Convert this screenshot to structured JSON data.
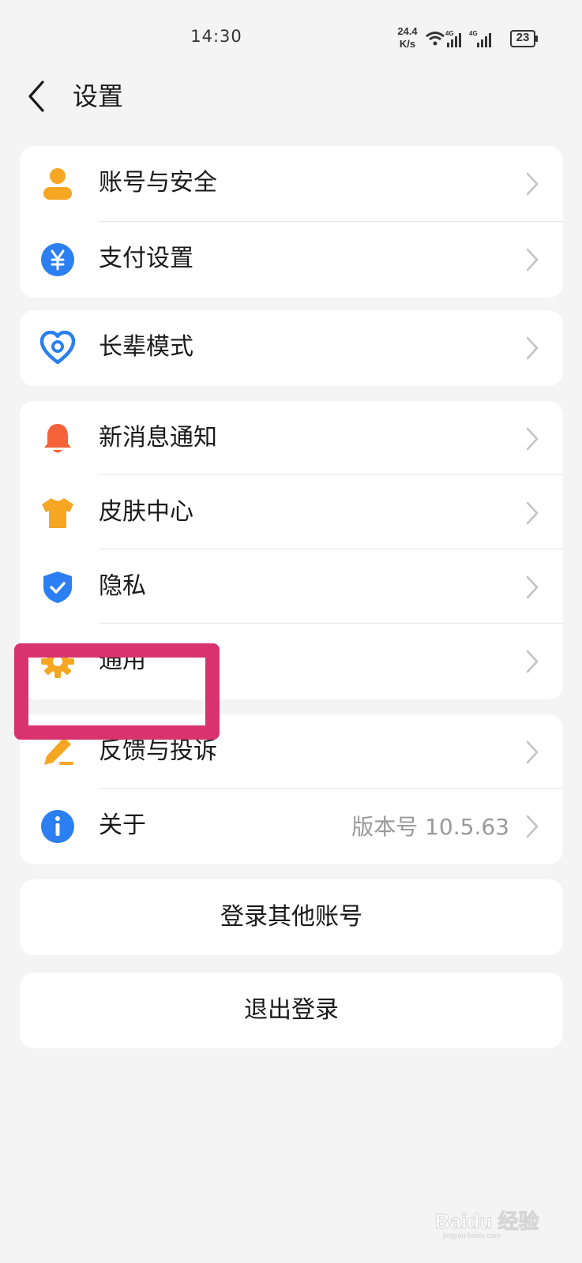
{
  "status_bar": {
    "time": "14:30",
    "net_speed_value": "24.4",
    "net_speed_unit": "K/s",
    "signal1_label": "4G",
    "signal2_label": "4G",
    "battery": "23"
  },
  "header": {
    "title": "设置"
  },
  "groups": [
    {
      "items": [
        {
          "label": "账号与安全",
          "icon": "user-icon"
        },
        {
          "label": "支付设置",
          "icon": "yuan-icon"
        }
      ]
    },
    {
      "items": [
        {
          "label": "长辈模式",
          "icon": "heart-icon"
        }
      ]
    },
    {
      "items": [
        {
          "label": "新消息通知",
          "icon": "bell-icon"
        },
        {
          "label": "皮肤中心",
          "icon": "shirt-icon"
        },
        {
          "label": "隐私",
          "icon": "shield-icon"
        },
        {
          "label": "通用",
          "icon": "gear-icon"
        }
      ]
    },
    {
      "items": [
        {
          "label": "反馈与投诉",
          "icon": "edit-icon"
        },
        {
          "label": "关于",
          "icon": "info-icon",
          "value": "版本号 10.5.63"
        }
      ]
    }
  ],
  "actions": {
    "switch_account": "登录其他账号",
    "logout": "退出登录"
  },
  "watermark": {
    "text": "Baidu 经验",
    "sub": "jingyan.baidu.com"
  },
  "colors": {
    "background": "#f4f4f4",
    "card": "#ffffff",
    "highlight": "#d8336e",
    "orange": "#f5a623",
    "blue": "#2b7ff0",
    "red": "#f4623a"
  }
}
